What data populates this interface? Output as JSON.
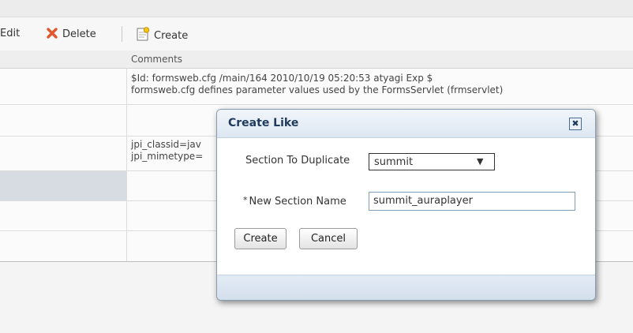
{
  "toolbar": {
    "edit_label": "Edit",
    "delete_label": "Delete",
    "create_label": "Create"
  },
  "table": {
    "comments_header": "Comments",
    "row1_line1": "$Id: formsweb.cfg /main/164 2010/10/19 05:20:53 atyagi Exp $",
    "row1_line2": "formsweb.cfg defines parameter values used by the FormsServlet (frmservlet)",
    "row3_line1": "jpi_classid=jav",
    "row3_line2": "jpi_mimetype="
  },
  "dialog": {
    "title": "Create Like",
    "close_glyph": "✖",
    "section_label": "Section To Duplicate",
    "section_value": "summit",
    "dropdown_glyph": "▼",
    "required_mark": "*",
    "name_label": "New Section Name",
    "name_value": "summit_auraplayer",
    "create_button": "Create",
    "cancel_button": "Cancel"
  },
  "colors": {
    "dialog_header": "#dde7f2",
    "dialog_border": "#8a9cb0",
    "delete_icon": "#e2572c",
    "selected_row": "#d7dce2"
  },
  "icons": [
    "delete-x-icon",
    "create-page-icon",
    "close-icon",
    "chevron-down-icon"
  ]
}
